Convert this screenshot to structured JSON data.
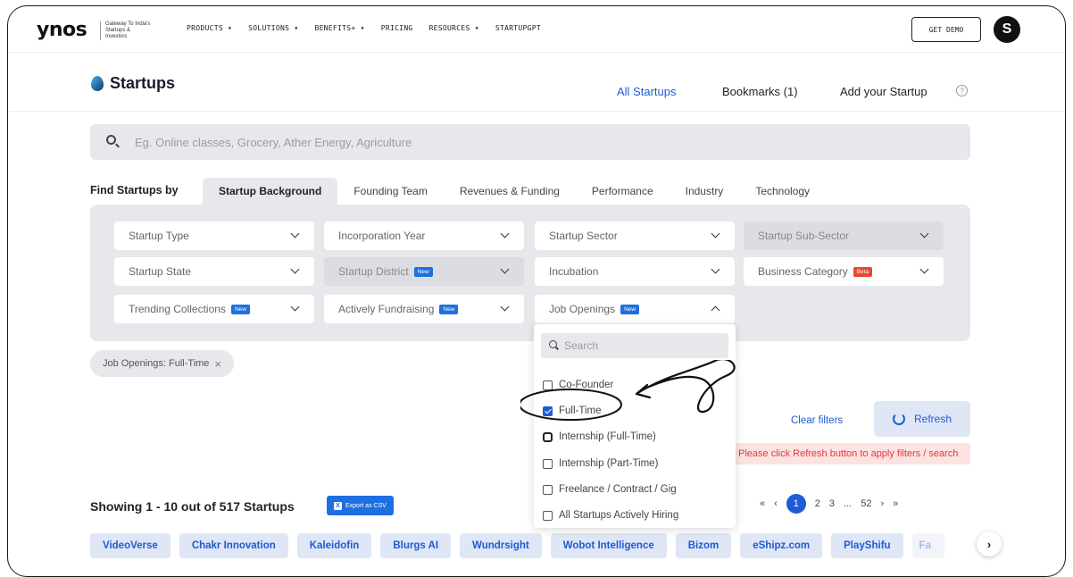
{
  "nav": {
    "logo": "ynos",
    "tagline": "Gateway To India's Startups & Investors",
    "links": [
      "PRODUCTS ▾",
      "SOLUTIONS ▾",
      "BENEFITS+ ▾",
      "PRICING",
      "RESOURCES ▾",
      "STARTUPGPT"
    ],
    "get_demo": "GET DEMO",
    "avatar_letter": "S"
  },
  "subheader": {
    "brand": "Startups",
    "all_startups": "All Startups",
    "bookmarks": "Bookmarks (1)",
    "add_startup": "Add your Startup",
    "help_glyph": "?"
  },
  "search": {
    "placeholder": "Eg. Online classes, Grocery, Ather Energy, Agriculture"
  },
  "filters": {
    "find_by": "Find Startups by",
    "tabs": [
      "Startup Background",
      "Founding Team",
      "Revenues & Funding",
      "Performance",
      "Industry",
      "Technology"
    ],
    "dropdowns": {
      "startup_type": "Startup Type",
      "incorporation_year": "Incorporation Year",
      "startup_sector": "Startup Sector",
      "startup_sub_sector": "Startup Sub-Sector",
      "startup_state": "Startup State",
      "startup_district": "Startup District",
      "incubation": "Incubation",
      "business_category": "Business Category",
      "trending_collections": "Trending Collections",
      "actively_fundraising": "Actively Fundraising",
      "job_openings": "Job Openings"
    },
    "badge_new": "New",
    "badge_beta": "Beta"
  },
  "active_chip": {
    "label": "Job Openings: Full-Time",
    "close": "×"
  },
  "job_menu": {
    "search_placeholder": "Search",
    "options": [
      {
        "label": "Co-Founder",
        "checked": false
      },
      {
        "label": "Full-Time",
        "checked": true
      },
      {
        "label": "Internship (Full-Time)",
        "checked": false
      },
      {
        "label": "Internship (Part-Time)",
        "checked": false
      },
      {
        "label": "Freelance / Contract / Gig",
        "checked": false
      },
      {
        "label": "All Startups Actively Hiring",
        "checked": false
      }
    ]
  },
  "actions": {
    "clear_filters": "Clear filters",
    "refresh": "Refresh",
    "warning": "Please click Refresh button to apply filters / search"
  },
  "results": {
    "showing": "Showing 1 - 10 out of 517 Startups",
    "export": "Export as CSV",
    "export_glyph": "X",
    "pager": {
      "first": "«",
      "prev": "‹",
      "current": "1",
      "p2": "2",
      "p3": "3",
      "ellipsis": "...",
      "last_page": "52",
      "next": "›",
      "last": "»"
    }
  },
  "companies": [
    "VideoVerse",
    "Chakr Innovation",
    "Kaleidofin",
    "Blurgs AI",
    "Wundrsight",
    "Wobot Intelligence",
    "Bizom",
    "eShipz.com",
    "PlayShifu",
    "Fa"
  ],
  "scroll_next": "›",
  "colors": {
    "accent": "#1e5bd6",
    "panel_bg": "#e7e8eb",
    "badge_new": "#1e6fe0",
    "badge_beta": "#e6492d",
    "warning": "#e23b3b"
  }
}
